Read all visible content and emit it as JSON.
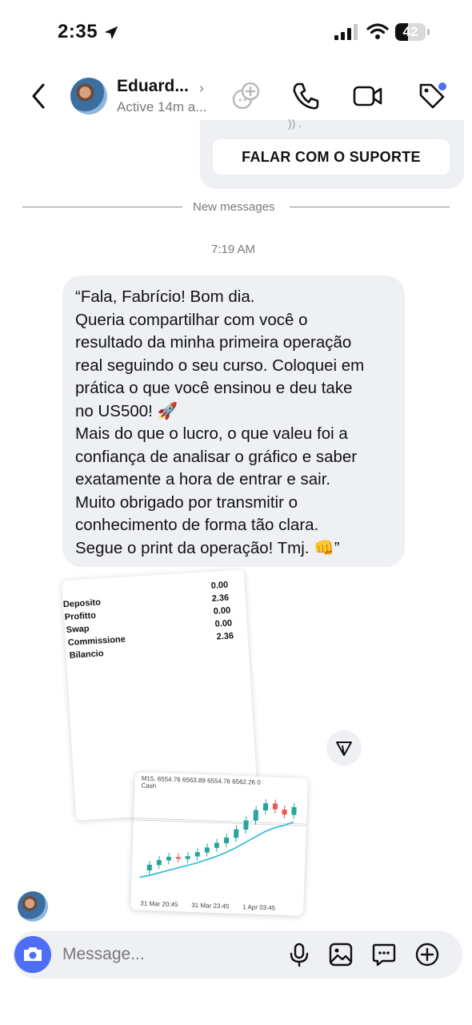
{
  "status_bar": {
    "time": "2:35",
    "battery": "42",
    "battery_level": 0.42
  },
  "header": {
    "contact_name": "Eduard...",
    "contact_status": "Active 14m a...",
    "icons": [
      "back-icon",
      "group-add-icon",
      "phone-icon",
      "video-icon",
      "tag-icon"
    ]
  },
  "previous_message": {
    "peek_text": ")) .",
    "button_label": "FALAR COM O SUPORTE"
  },
  "divider": {
    "label": "New messages"
  },
  "timestamp": "7:19 AM",
  "message": {
    "text": "“Fala, Fabrício! Bom dia.\nQueria compartilhar com você o\nresultado da minha primeira operação\nreal seguindo o seu curso. Coloquei em\nprática o que você ensinou e deu take\nno US500! 🚀\nMais do que o lucro, o que valeu foi a\nconfiança de analisar o gráfico e saber\nexatamente a hora de entrar e sair.\nMuito obrigado por transmitir o\nconhecimento de forma tão clara.\nSegue o print da operação! Tmj. 👊”"
  },
  "print_summary": {
    "rows": [
      {
        "label": "Deposito",
        "value": "0.00"
      },
      {
        "label": "Profitto",
        "value": "2.36"
      },
      {
        "label": "Swap",
        "value": "0.00"
      },
      {
        "label": "Commissione",
        "value": "0.00"
      },
      {
        "label": "Bilancio",
        "value": "2.36"
      }
    ]
  },
  "chart_data": {
    "type": "line",
    "title": "",
    "header_text": "M15, 6554.76 6563.89 6554.76 6562.26 0",
    "subheader_text": "Cash",
    "x_labels": [
      "31 Mar 20:45",
      "31 Mar 23:45",
      "1 Apr 03:45"
    ],
    "series": [
      {
        "values": [
          6470,
          6478,
          6485,
          6490,
          6488,
          6492,
          6498,
          6505,
          6512,
          6520,
          6532,
          6545,
          6560,
          6570,
          6562,
          6555,
          6566
        ]
      },
      {
        "values": [
          6460,
          6463,
          6467,
          6471,
          6475,
          6479,
          6483,
          6488,
          6493,
          6499,
          6506,
          6514,
          6522,
          6530,
          6536,
          6540,
          6545
        ]
      }
    ]
  },
  "composer": {
    "placeholder": "Message..."
  }
}
